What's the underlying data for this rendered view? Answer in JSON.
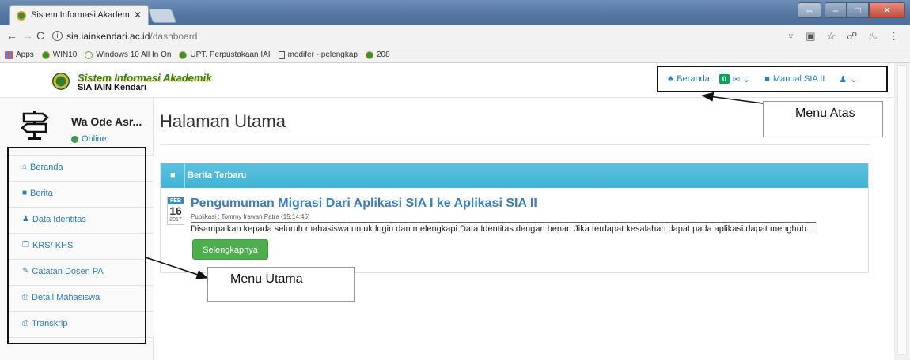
{
  "browser": {
    "tab_title": "Sistem Informasi Akadem",
    "url_host": "sia.iainkendari.ac.id",
    "url_path": "/dashboard",
    "bookmarks": [
      "Apps",
      "WIN10",
      "Windows 10 All In On",
      "UPT. Perpustakaan IAI",
      "modifer - pelengkap",
      "208"
    ]
  },
  "header": {
    "logo_title": "Sistem Informasi Akademik",
    "logo_subtitle": "SIA IAIN Kendari",
    "top_menu": {
      "home_label": "Beranda",
      "mail_count": "0",
      "manual_label": "Manual SIA II"
    }
  },
  "sidebar": {
    "user_name": "Wa Ode Asr...",
    "user_status": "Online",
    "items": [
      {
        "label": "Beranda",
        "icon": "home-icon",
        "glyph": "⌂"
      },
      {
        "label": "Berita",
        "icon": "book-icon",
        "glyph": "■"
      },
      {
        "label": "Data Identitas",
        "icon": "user-icon",
        "glyph": "♟"
      },
      {
        "label": "KRS/ KHS",
        "icon": "folder-icon",
        "glyph": "❐"
      },
      {
        "label": "Catatan Dosen PA",
        "icon": "edit-icon",
        "glyph": "✎"
      },
      {
        "label": "Detail Mahasiswa",
        "icon": "print-icon",
        "glyph": "⎙"
      },
      {
        "label": "Transkrip",
        "icon": "print-icon",
        "glyph": "⎙"
      }
    ]
  },
  "main": {
    "page_title": "Halaman Utama",
    "news": {
      "header": "Berita Terbaru",
      "date_month": "FEB",
      "date_day": "16",
      "date_year": "2017",
      "title": "Pengumuman Migrasi Dari Aplikasi SIA I ke Aplikasi SIA II",
      "meta": "Publikasi : Tommy Irawan Patra (15:14:46)",
      "body": "Disampaikan kepada seluruh mahasiswa untuk login dan melengkapi Data Identitas dengan benar. Jika terdapat kesalahan dapat pada aplikasi dapat menghub...",
      "more_label": "Selengkapnya"
    }
  },
  "annotations": {
    "top_menu_label": "Menu Atas",
    "main_menu_label": "Menu Utama"
  }
}
